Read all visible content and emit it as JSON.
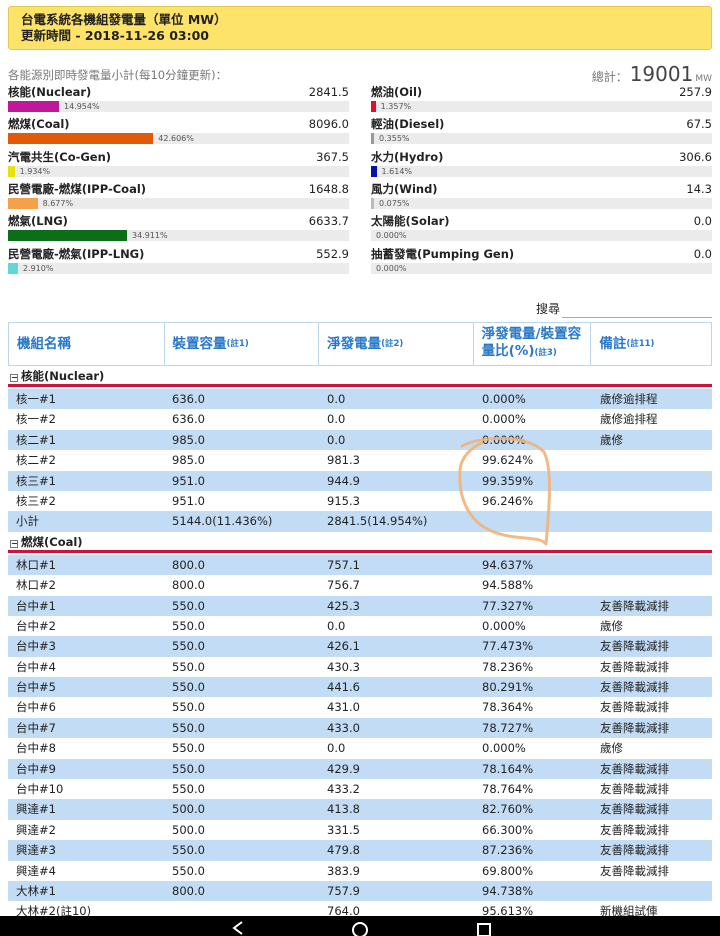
{
  "header": {
    "title": "台電系統各機組發電量（單位 MW）",
    "updated": "更新時間 - 2018-11-26 03:00"
  },
  "summary": {
    "note": "各能源別即時發電量小計(每10分鐘更新)：",
    "total_label": "總計：",
    "total_value": "19001",
    "total_unit": "MW",
    "left": [
      {
        "name": "核能(Nuclear)",
        "value": "2841.5",
        "pct": "14.954%",
        "ratio": 0.14954,
        "color": "#c0189a"
      },
      {
        "name": "燃煤(Coal)",
        "value": "8096.0",
        "pct": "42.606%",
        "ratio": 0.42606,
        "color": "#e05a08"
      },
      {
        "name": "汽電共生(Co-Gen)",
        "value": "367.5",
        "pct": "1.934%",
        "ratio": 0.01934,
        "color": "#e8e010"
      },
      {
        "name": "民營電廠-燃煤(IPP-Coal)",
        "value": "1648.8",
        "pct": "8.677%",
        "ratio": 0.08677,
        "color": "#f5a14a"
      },
      {
        "name": "燃氣(LNG)",
        "value": "6633.7",
        "pct": "34.911%",
        "ratio": 0.34911,
        "color": "#0c6e16"
      },
      {
        "name": "民營電廠-燃氣(IPP-LNG)",
        "value": "552.9",
        "pct": "2.910%",
        "ratio": 0.0291,
        "color": "#5fd8d8"
      }
    ],
    "right": [
      {
        "name": "燃油(Oil)",
        "value": "257.9",
        "pct": "1.357%",
        "ratio": 0.01357,
        "color": "#e0102a"
      },
      {
        "name": "輕油(Diesel)",
        "value": "67.5",
        "pct": "0.355%",
        "ratio": 0.00355,
        "color": "#999999"
      },
      {
        "name": "水力(Hydro)",
        "value": "306.6",
        "pct": "1.614%",
        "ratio": 0.01614,
        "color": "#0a10b0"
      },
      {
        "name": "風力(Wind)",
        "value": "14.3",
        "pct": "0.075%",
        "ratio": 0.00075,
        "color": "#bbbbbb"
      },
      {
        "name": "太陽能(Solar)",
        "value": "0.0",
        "pct": "0.000%",
        "ratio": 0,
        "color": "#bbbbbb"
      },
      {
        "name": "抽蓄發電(Pumping Gen)",
        "value": "0.0",
        "pct": "0.000%",
        "ratio": 0,
        "color": "#bbbbbb"
      }
    ]
  },
  "search": {
    "label": "搜尋",
    "value": ""
  },
  "table": {
    "headers": [
      {
        "label": "機組名稱",
        "note": ""
      },
      {
        "label": "裝置容量",
        "note": "(註1)"
      },
      {
        "label": "淨發電量",
        "note": "(註2)"
      },
      {
        "label": "淨發電量/裝置容量比(%)",
        "note": "(註3)"
      },
      {
        "label": "備註",
        "note": "(註11)"
      }
    ],
    "groups": [
      {
        "name": "核能(Nuclear)",
        "rows": [
          [
            "核一#1",
            "636.0",
            "0.0",
            "0.000%",
            "歲修逾排程"
          ],
          [
            "核一#2",
            "636.0",
            "0.0",
            "0.000%",
            "歲修逾排程"
          ],
          [
            "核二#1",
            "985.0",
            "0.0",
            "0.000%",
            "歲修"
          ],
          [
            "核二#2",
            "985.0",
            "981.3",
            "99.624%",
            ""
          ],
          [
            "核三#1",
            "951.0",
            "944.9",
            "99.359%",
            ""
          ],
          [
            "核三#2",
            "951.0",
            "915.3",
            "96.246%",
            ""
          ],
          [
            "小計",
            "5144.0(11.436%)",
            "2841.5(14.954%)",
            "",
            ""
          ]
        ]
      },
      {
        "name": "燃煤(Coal)",
        "rows": [
          [
            "林口#1",
            "800.0",
            "757.1",
            "94.637%",
            ""
          ],
          [
            "林口#2",
            "800.0",
            "756.7",
            "94.588%",
            ""
          ],
          [
            "台中#1",
            "550.0",
            "425.3",
            "77.327%",
            "友善降載減排"
          ],
          [
            "台中#2",
            "550.0",
            "0.0",
            "0.000%",
            "歲修"
          ],
          [
            "台中#3",
            "550.0",
            "426.1",
            "77.473%",
            "友善降載減排"
          ],
          [
            "台中#4",
            "550.0",
            "430.3",
            "78.236%",
            "友善降載減排"
          ],
          [
            "台中#5",
            "550.0",
            "441.6",
            "80.291%",
            "友善降載減排"
          ],
          [
            "台中#6",
            "550.0",
            "431.0",
            "78.364%",
            "友善降載減排"
          ],
          [
            "台中#7",
            "550.0",
            "433.0",
            "78.727%",
            "友善降載減排"
          ],
          [
            "台中#8",
            "550.0",
            "0.0",
            "0.000%",
            "歲修"
          ],
          [
            "台中#9",
            "550.0",
            "429.9",
            "78.164%",
            "友善降載減排"
          ],
          [
            "台中#10",
            "550.0",
            "433.2",
            "78.764%",
            "友善降載減排"
          ],
          [
            "興達#1",
            "500.0",
            "413.8",
            "82.760%",
            "友善降載減排"
          ],
          [
            "興達#2",
            "500.0",
            "331.5",
            "66.300%",
            "友善降載減排"
          ],
          [
            "興達#3",
            "550.0",
            "479.8",
            "87.236%",
            "友善降載減排"
          ],
          [
            "興達#4",
            "550.0",
            "383.9",
            "69.800%",
            "友善降載減排"
          ],
          [
            "大林#1",
            "800.0",
            "757.9",
            "94.738%",
            ""
          ],
          [
            "大林#2(註10)",
            "",
            "764.0",
            "95.613%",
            "新機組試俥"
          ]
        ]
      }
    ]
  },
  "colors": {
    "header_bg": "#fde36a",
    "accent_red": "#c8163f",
    "link_blue": "#2a79c8",
    "row_alt": "#c3dcf5"
  }
}
